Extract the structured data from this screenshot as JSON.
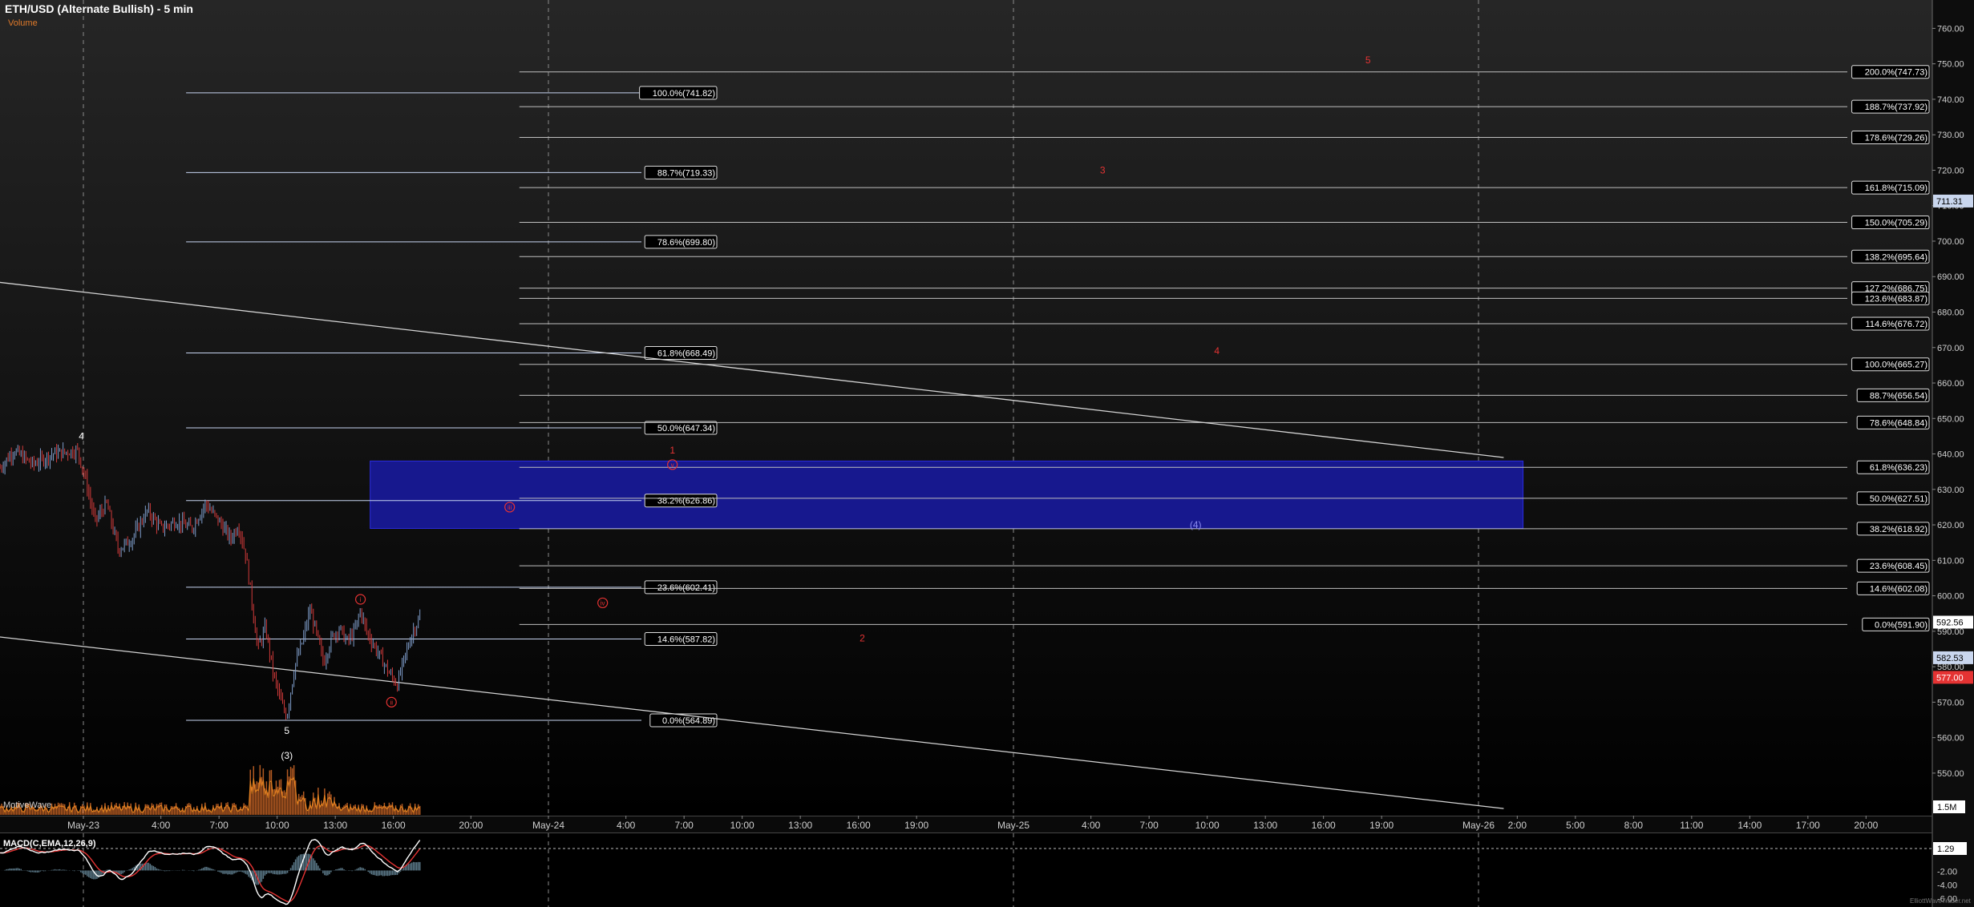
{
  "chart": {
    "title": "ETH/USD (Alternate Bullish) - 5 min",
    "volume_label": "Volume",
    "watermark": "MotiveWave",
    "macd_label": "MACD(C,EMA,12,26,9)",
    "credit": "ElliottWaveTrader.net"
  },
  "colors": {
    "background_top": "#262626",
    "background_bottom": "#000000",
    "grid": "#8a8a8a",
    "fib_left": "#c6d3f0",
    "fib_right": "#bfbfbf",
    "candle_up": "#7e9cc9",
    "candle_down": "#d13a3a",
    "wave_red": "#e53333",
    "wave_blue": "#8b8bf0",
    "box_fill": "#17188e",
    "macd_line": "#ffffff",
    "macd_signal": "#e53333",
    "macd_hist": "#5c7a8a",
    "volume_bar": "#b35a22",
    "volume_line": "#e08020",
    "price_tag_blue": "#c9d6ee",
    "price_tag_red": "#e53333"
  },
  "chart_data": {
    "type": "candlestick",
    "title": "ETH/USD (Alternate Bullish) - 5 min",
    "ylim": [
      538,
      768
    ],
    "y_ticks": [
      550,
      560,
      570,
      580,
      590,
      600,
      610,
      620,
      630,
      640,
      650,
      660,
      670,
      680,
      690,
      700,
      710,
      720,
      730,
      740,
      750,
      760
    ],
    "y_tick_labels": [
      "550.00",
      "560.00",
      "570.00",
      "580.00",
      "590.00",
      "600.00",
      "610.00",
      "620.00",
      "630.00",
      "640.00",
      "650.00",
      "660.00",
      "670.00",
      "680.00",
      "690.00",
      "700.00",
      "710.00",
      "720.00",
      "730.00",
      "740.00",
      "750.00",
      "760.00"
    ],
    "x_labels": [
      {
        "t": 0,
        "label": "May-23"
      },
      {
        "t": 4,
        "label": "4:00"
      },
      {
        "t": 7,
        "label": "7:00"
      },
      {
        "t": 10,
        "label": "10:00"
      },
      {
        "t": 13,
        "label": "13:00"
      },
      {
        "t": 16,
        "label": "16:00"
      },
      {
        "t": 20,
        "label": "20:00"
      },
      {
        "t": 24,
        "label": "May-24"
      },
      {
        "t": 28,
        "label": "4:00"
      },
      {
        "t": 31,
        "label": "7:00"
      },
      {
        "t": 34,
        "label": "10:00"
      },
      {
        "t": 37,
        "label": "13:00"
      },
      {
        "t": 40,
        "label": "16:00"
      },
      {
        "t": 43,
        "label": "19:00"
      },
      {
        "t": 48,
        "label": "May-25"
      },
      {
        "t": 52,
        "label": "4:00"
      },
      {
        "t": 55,
        "label": "7:00"
      },
      {
        "t": 58,
        "label": "10:00"
      },
      {
        "t": 61,
        "label": "13:00"
      },
      {
        "t": 64,
        "label": "16:00"
      },
      {
        "t": 67,
        "label": "19:00"
      },
      {
        "t": 72,
        "label": "May-26"
      },
      {
        "t": 74,
        "label": "2:00"
      },
      {
        "t": 77,
        "label": "5:00"
      },
      {
        "t": 80,
        "label": "8:00"
      },
      {
        "t": 83,
        "label": "11:00"
      },
      {
        "t": 86,
        "label": "14:00"
      },
      {
        "t": 89,
        "label": "17:00"
      },
      {
        "t": 92,
        "label": "20:00"
      }
    ],
    "day_separators": [
      0,
      24,
      48,
      72
    ],
    "price_path": [
      {
        "t": -4.3,
        "p": 636
      },
      {
        "t": -3.6,
        "p": 641
      },
      {
        "t": -2.6,
        "p": 637
      },
      {
        "t": -1.6,
        "p": 640
      },
      {
        "t": -0.3,
        "p": 641
      },
      {
        "t": 0.1,
        "p": 633
      },
      {
        "t": 0.6,
        "p": 621
      },
      {
        "t": 1.2,
        "p": 626
      },
      {
        "t": 1.8,
        "p": 613
      },
      {
        "t": 2.5,
        "p": 616
      },
      {
        "t": 3.3,
        "p": 624
      },
      {
        "t": 4.0,
        "p": 619
      },
      {
        "t": 4.8,
        "p": 621
      },
      {
        "t": 5.6,
        "p": 619
      },
      {
        "t": 6.3,
        "p": 626
      },
      {
        "t": 7.0,
        "p": 621
      },
      {
        "t": 7.6,
        "p": 616
      },
      {
        "t": 8.0,
        "p": 620
      },
      {
        "t": 8.4,
        "p": 611
      },
      {
        "t": 8.7,
        "p": 598
      },
      {
        "t": 9.0,
        "p": 585
      },
      {
        "t": 9.4,
        "p": 591
      },
      {
        "t": 9.8,
        "p": 578
      },
      {
        "t": 10.2,
        "p": 570
      },
      {
        "t": 10.5,
        "p": 566
      },
      {
        "t": 10.9,
        "p": 580
      },
      {
        "t": 11.3,
        "p": 587
      },
      {
        "t": 11.7,
        "p": 596
      },
      {
        "t": 12.0,
        "p": 590
      },
      {
        "t": 12.4,
        "p": 581
      },
      {
        "t": 12.8,
        "p": 588
      },
      {
        "t": 13.2,
        "p": 591
      },
      {
        "t": 13.6,
        "p": 587
      },
      {
        "t": 14.0,
        "p": 590
      },
      {
        "t": 14.3,
        "p": 596
      },
      {
        "t": 14.6,
        "p": 590
      },
      {
        "t": 15.0,
        "p": 586
      },
      {
        "t": 15.4,
        "p": 582
      },
      {
        "t": 15.8,
        "p": 578
      },
      {
        "t": 16.2,
        "p": 575
      },
      {
        "t": 16.6,
        "p": 583
      },
      {
        "t": 17.0,
        "p": 590
      },
      {
        "t": 17.4,
        "p": 594
      }
    ],
    "fib_left": [
      {
        "pct": "100.0%",
        "price": 741.82,
        "label": "100.0%(741.82)"
      },
      {
        "pct": "88.7%",
        "price": 719.33,
        "label": "88.7%(719.33)"
      },
      {
        "pct": "78.6%",
        "price": 699.8,
        "label": "78.6%(699.80)"
      },
      {
        "pct": "61.8%",
        "price": 668.49,
        "label": "61.8%(668.49)"
      },
      {
        "pct": "50.0%",
        "price": 647.34,
        "label": "50.0%(647.34)"
      },
      {
        "pct": "38.2%",
        "price": 626.86,
        "label": "38.2%(626.86)"
      },
      {
        "pct": "23.6%",
        "price": 602.41,
        "label": "23.6%(602.41)"
      },
      {
        "pct": "14.6%",
        "price": 587.82,
        "label": "14.6%(587.82)"
      },
      {
        "pct": "0.0%",
        "price": 564.89,
        "label": "0.0%(564.89)"
      }
    ],
    "fib_right": [
      {
        "pct": "200.0%",
        "price": 747.73,
        "label": "200.0%(747.73)"
      },
      {
        "pct": "188.7%",
        "price": 737.92,
        "label": "188.7%(737.92)"
      },
      {
        "pct": "178.6%",
        "price": 729.26,
        "label": "178.6%(729.26)"
      },
      {
        "pct": "161.8%",
        "price": 715.09,
        "label": "161.8%(715.09)"
      },
      {
        "pct": "150.0%",
        "price": 705.29,
        "label": "150.0%(705.29)"
      },
      {
        "pct": "138.2%",
        "price": 695.64,
        "label": "138.2%(695.64)"
      },
      {
        "pct": "127.2%",
        "price": 686.75,
        "label": "127.2%(686.75)"
      },
      {
        "pct": "123.6%",
        "price": 683.87,
        "label": "123.6%(683.87)"
      },
      {
        "pct": "114.6%",
        "price": 676.72,
        "label": "114.6%(676.72)"
      },
      {
        "pct": "100.0%",
        "price": 665.27,
        "label": "100.0%(665.27)"
      },
      {
        "pct": "88.7%",
        "price": 656.54,
        "label": "88.7%(656.54)"
      },
      {
        "pct": "78.6%",
        "price": 648.84,
        "label": "78.6%(648.84)"
      },
      {
        "pct": "61.8%",
        "price": 636.23,
        "label": "61.8%(636.23)"
      },
      {
        "pct": "50.0%",
        "price": 627.51,
        "label": "50.0%(627.51)"
      },
      {
        "pct": "38.2%",
        "price": 618.92,
        "label": "38.2%(618.92)"
      },
      {
        "pct": "23.6%",
        "price": 608.45,
        "label": "23.6%(608.45)"
      },
      {
        "pct": "14.6%",
        "price": 602.08,
        "label": "14.6%(602.08)"
      },
      {
        "pct": "0.0%",
        "price": 591.9,
        "label": "0.0%(591.90)"
      }
    ],
    "target_box": {
      "t_start": 14.8,
      "t_end": 74.3,
      "price_top": 638,
      "price_bottom": 619
    },
    "trendlines": [
      {
        "t1": -5.3,
        "p1": 689,
        "t2": 73.3,
        "p2": 639
      },
      {
        "t1": -5.3,
        "p1": 589,
        "t2": 73.3,
        "p2": 540
      }
    ],
    "wave_labels": [
      {
        "text": "4",
        "t": -0.1,
        "p": 645,
        "color": "white"
      },
      {
        "text": "5",
        "t": 10.5,
        "p": 562,
        "color": "white"
      },
      {
        "text": "(3)",
        "t": 10.5,
        "p": 555,
        "color": "white"
      },
      {
        "text": "(4)",
        "t": 57.4,
        "p": 620,
        "color": "blue"
      },
      {
        "text": "1",
        "t": 30.4,
        "p": 641,
        "color": "red"
      },
      {
        "text": "2",
        "t": 40.2,
        "p": 588,
        "color": "red"
      },
      {
        "text": "3",
        "t": 52.6,
        "p": 720,
        "color": "red"
      },
      {
        "text": "4",
        "t": 58.5,
        "p": 669,
        "color": "red"
      },
      {
        "text": "5",
        "t": 66.3,
        "p": 751,
        "color": "red"
      }
    ],
    "wave_circles": [
      {
        "text": "i",
        "t": 14.3,
        "p": 599
      },
      {
        "text": "ii",
        "t": 15.9,
        "p": 570
      },
      {
        "text": "iii",
        "t": 22.0,
        "p": 625
      },
      {
        "text": "iv",
        "t": 26.8,
        "p": 598
      },
      {
        "text": "v",
        "t": 30.4,
        "p": 637
      }
    ],
    "price_tags": [
      {
        "price": 711.31,
        "label": "711.31",
        "style": "blue"
      },
      {
        "price": 592.56,
        "label": "592.56",
        "style": "white"
      },
      {
        "price": 582.53,
        "label": "582.53",
        "style": "blue"
      },
      {
        "price": 577.0,
        "label": "577.00",
        "style": "red"
      }
    ],
    "volume_axis_label": "1.5M",
    "macd": {
      "ylim": [
        -7.2,
        3.5
      ],
      "ticks": [
        {
          "v": 1.29,
          "label": "1.29",
          "style": "white"
        },
        {
          "v": -2.0,
          "label": "-2.00",
          "style": "plain"
        },
        {
          "v": -4.0,
          "label": "-4.00",
          "style": "plain"
        },
        {
          "v": -6.0,
          "label": "-6.00",
          "style": "plain"
        }
      ]
    }
  }
}
